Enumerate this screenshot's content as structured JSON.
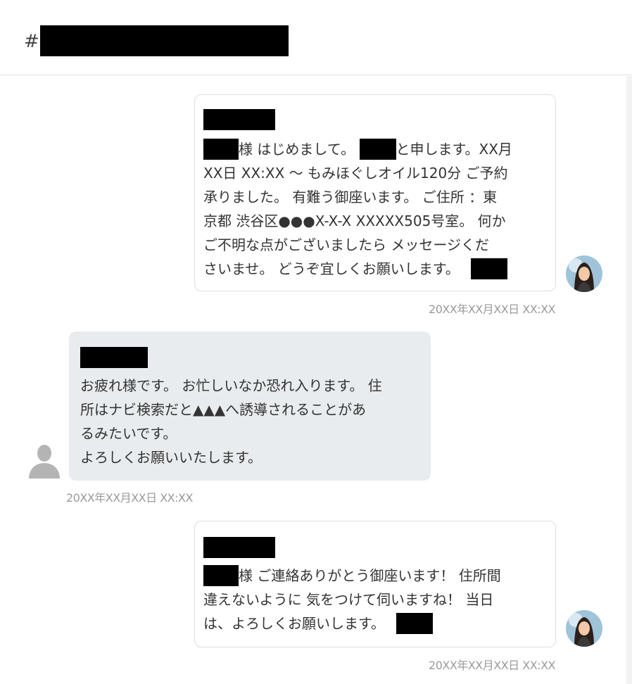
{
  "header": {
    "hash": "#"
  },
  "messages": [
    {
      "direction": "outgoing",
      "lines": {
        "l1_suffix": "様 はじめまして。",
        "l1_tail": "と申します。XX月",
        "l2": "XX日 XX:XX 〜 もみほぐしオイル120分 ご予約",
        "l3": "承りました。 有難う御座います。 ご住所 ：東",
        "l4": "京都 渋谷区●●●X-X-X XXXXX505号室。 何か",
        "l5": "ご不明な点がございましたら メッセージくだ",
        "l6": "さいませ。 どうぞ宜しくお願いします。"
      },
      "timestamp": "20XX年XX月XX日 XX:XX"
    },
    {
      "direction": "incoming",
      "lines": {
        "l1": "お疲れ様です。 お忙しいなか恐れ入ります。 住",
        "l2": "所はナビ検索だと▲▲▲へ誘導されることがあ",
        "l3": "るみたいです。",
        "l4": "よろしくお願いいたします。"
      },
      "timestamp": "20XX年XX月XX日 XX:XX"
    },
    {
      "direction": "outgoing",
      "lines": {
        "l1_suffix": "様 ご連絡ありがとう御座います！ 住所間",
        "l2": "違えないように 気をつけて伺いますね！ 当日",
        "l3": "は、よろしくお願いします。"
      },
      "timestamp": "20XX年XX月XX日 XX:XX"
    }
  ],
  "colors": {
    "incoming_bubble": "#e8ecef",
    "outgoing_border": "#dedede",
    "timestamp": "#9a9a9a"
  },
  "icons": {
    "agent_avatar": "woman-avatar-icon",
    "user_avatar": "person-silhouette-icon"
  }
}
